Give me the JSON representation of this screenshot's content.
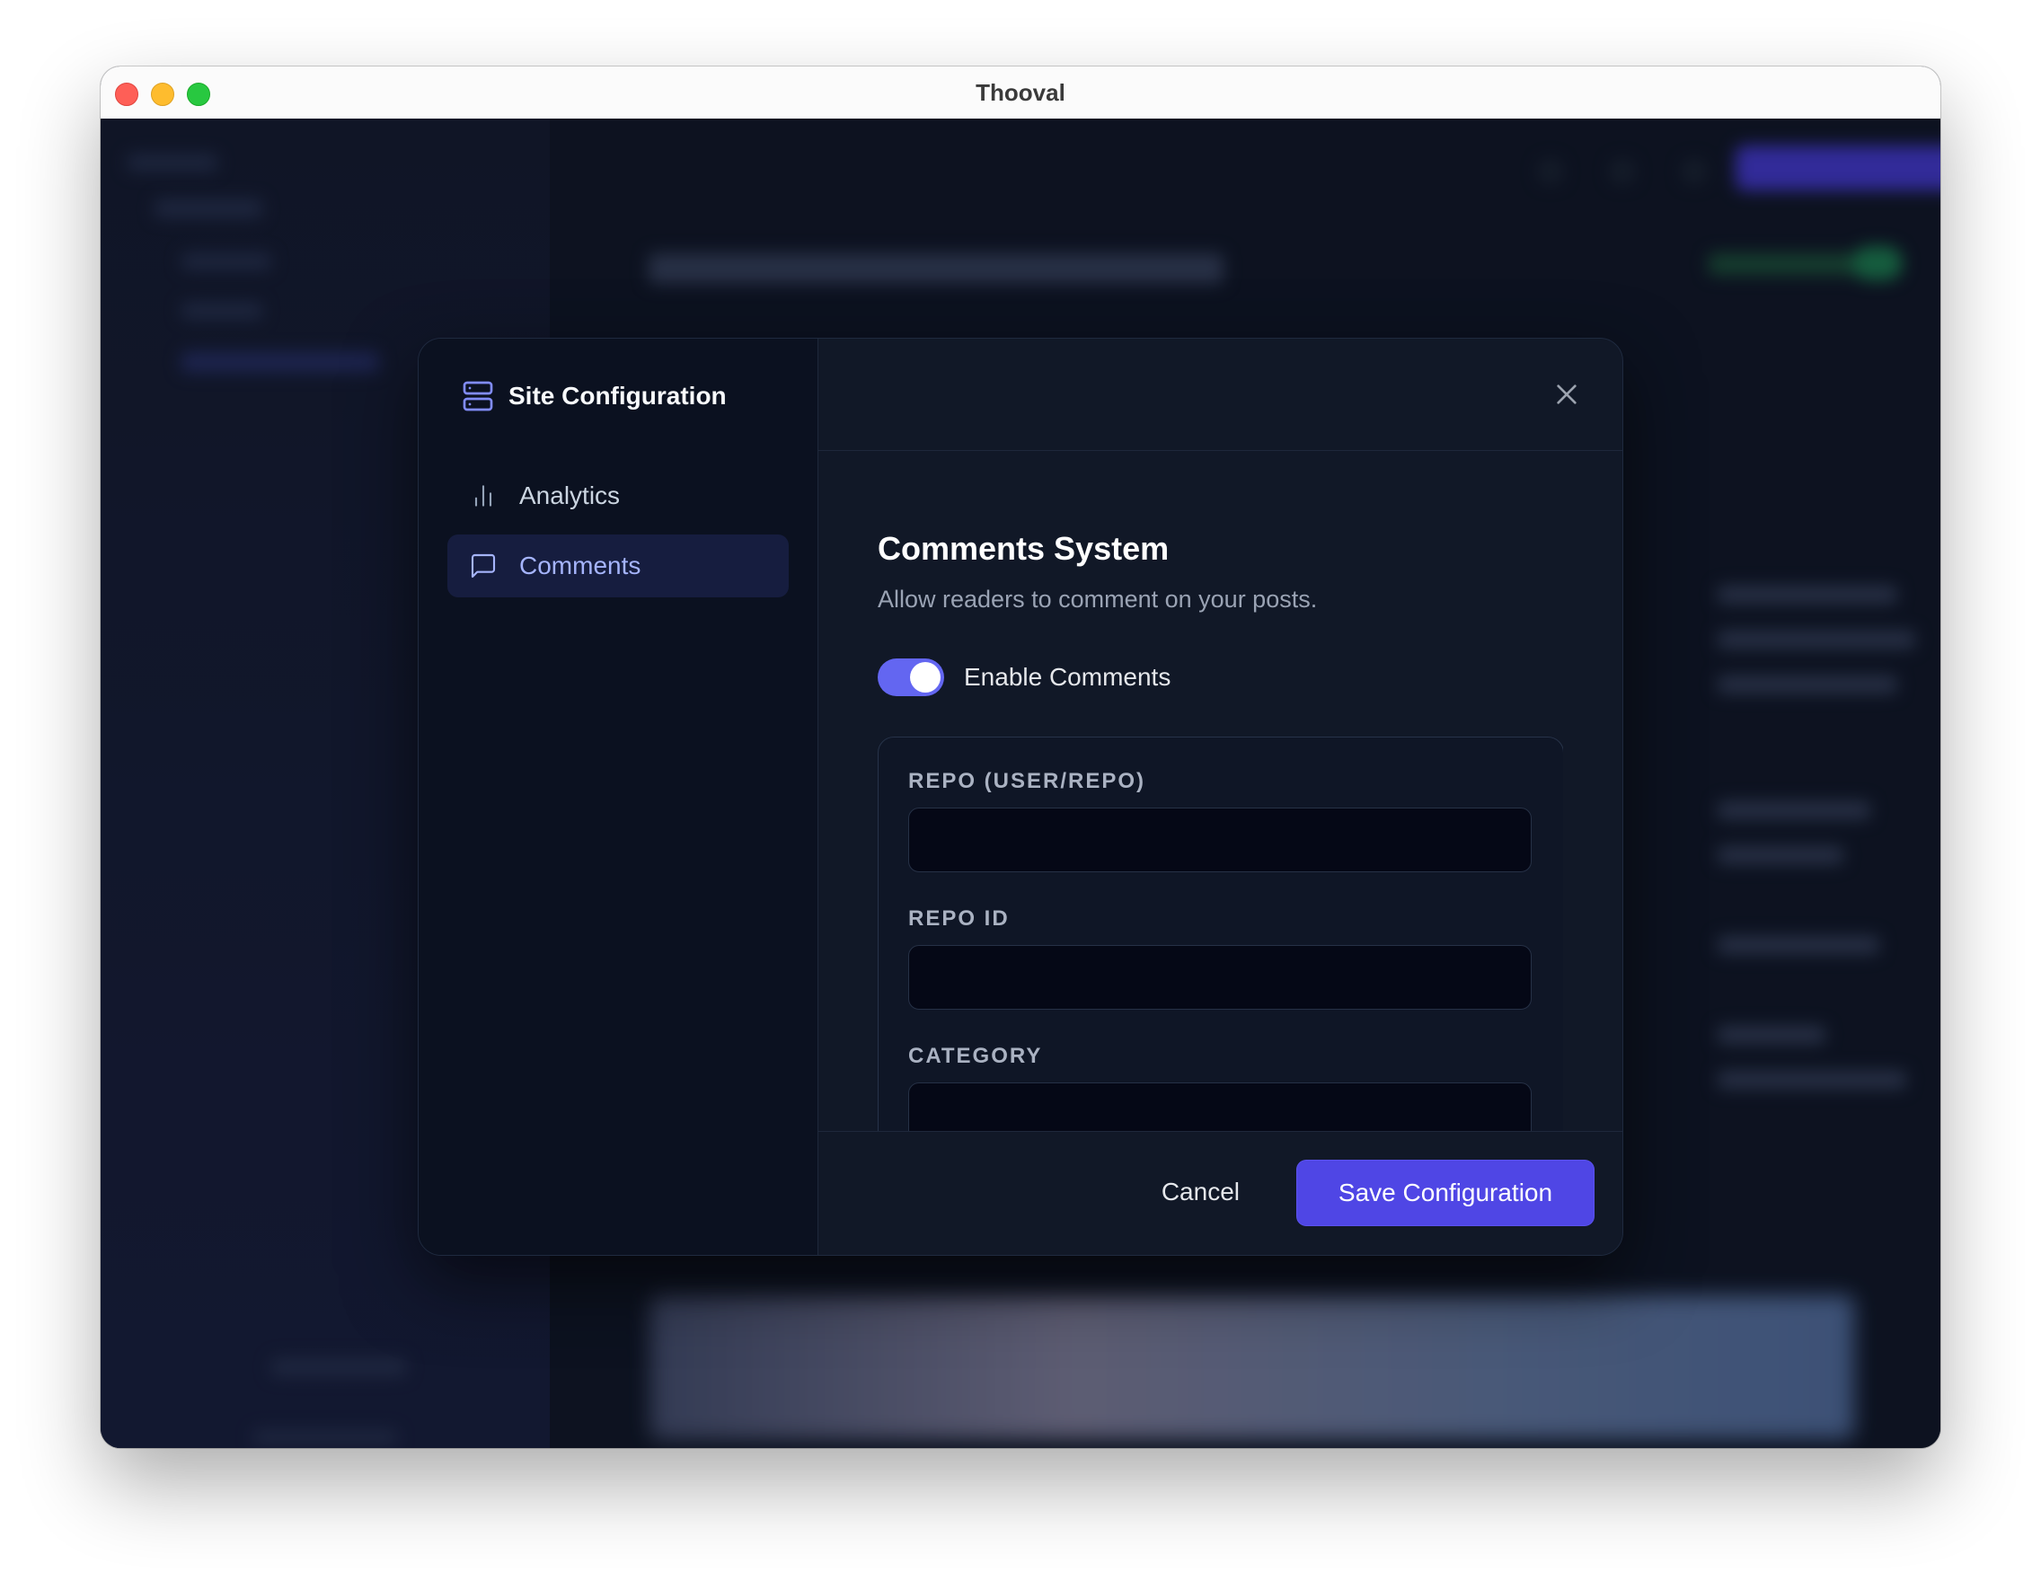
{
  "window": {
    "title": "Thooval"
  },
  "modal": {
    "sidebar": {
      "title": "Site Configuration",
      "title_icon": "server-icon",
      "items": [
        {
          "label": "Analytics",
          "icon": "bar-chart-icon",
          "active": false
        },
        {
          "label": "Comments",
          "icon": "message-square-icon",
          "active": true
        }
      ]
    },
    "section": {
      "title": "Comments System",
      "description": "Allow readers to comment on your posts."
    },
    "toggle": {
      "label": "Enable Comments",
      "enabled": true
    },
    "fields": [
      {
        "label": "REPO (USER/REPO)",
        "value": ""
      },
      {
        "label": "REPO ID",
        "value": ""
      },
      {
        "label": "CATEGORY",
        "value": ""
      }
    ],
    "footer": {
      "cancel_label": "Cancel",
      "save_label": "Save Configuration"
    }
  },
  "colors": {
    "accent": "#4f46e5",
    "toggle_on": "#6366f1",
    "active_nav_text": "#a5b4fc",
    "modal_bg": "#111827",
    "sidebar_bg": "#0b1120"
  }
}
